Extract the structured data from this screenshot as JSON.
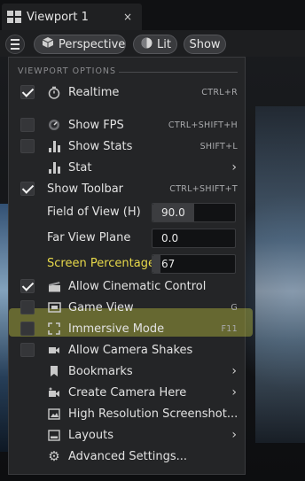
{
  "tab": {
    "title": "Viewport 1",
    "close": "×"
  },
  "toolbar": {
    "perspective_label": "Perspective",
    "lit_label": "Lit",
    "show_label": "Show"
  },
  "menu": {
    "section_title": "VIEWPORT OPTIONS",
    "items": [
      {
        "label": "Realtime",
        "shortcut": "CTRL+R",
        "checked": true,
        "icon": "stopwatch-icon"
      },
      {
        "label": "Show FPS",
        "shortcut": "CTRL+SHIFT+H",
        "checked": false,
        "icon": "gauge-icon"
      },
      {
        "label": "Show Stats",
        "shortcut": "SHIFT+L",
        "checked": false,
        "icon": "bar-chart-icon"
      },
      {
        "label": "Stat",
        "icon": "bar-chart-icon",
        "submenu": true
      },
      {
        "label": "Show Toolbar",
        "shortcut": "CTRL+SHIFT+T",
        "checked": true
      },
      {
        "label": "Field of View (H)",
        "value": "90.0",
        "fill_fraction": 0.5
      },
      {
        "label": "Far View Plane",
        "value": "0.0"
      },
      {
        "label": "Screen Percentage",
        "value": "67",
        "fill_fraction": 0.1,
        "highlight_color": "#e1e646"
      },
      {
        "label": "Allow Cinematic Control",
        "checked": true,
        "icon": "clapperboard-icon"
      },
      {
        "label": "Game View",
        "shortcut": "G",
        "checked": false,
        "icon": "game-view-icon"
      },
      {
        "label": "Immersive Mode",
        "shortcut": "F11",
        "checked": false,
        "icon": "fullscreen-icon"
      },
      {
        "label": "Allow Camera Shakes",
        "checked": false,
        "icon": "camera-icon"
      },
      {
        "label": "Bookmarks",
        "icon": "bookmark-icon",
        "submenu": true
      },
      {
        "label": "Create Camera Here",
        "icon": "camera-plus-icon",
        "submenu": true
      },
      {
        "label": "High Resolution Screenshot...",
        "icon": "screenshot-icon"
      },
      {
        "label": "Layouts",
        "icon": "layout-icon",
        "submenu": true
      },
      {
        "label": "Advanced Settings...",
        "icon": "gear-icon"
      }
    ]
  }
}
